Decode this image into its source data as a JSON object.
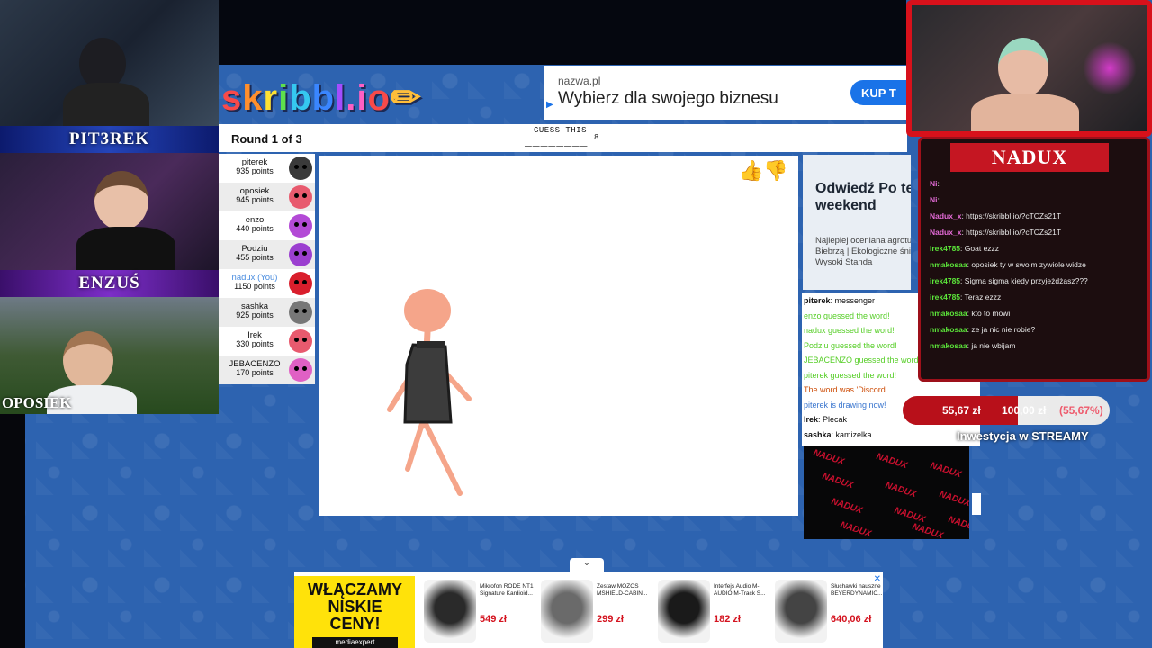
{
  "streamers": {
    "pit3rek": "PIT3REK",
    "enzus": "ENZUŚ",
    "oposiek": "OPOSIEK",
    "nadux": "NADUX"
  },
  "logo": "skribbl.io",
  "ad_top": {
    "domain": "nazwa.pl",
    "headline": "Wybierz dla swojego biznesu",
    "cta": "KUP T"
  },
  "game": {
    "round": "Round 1 of 3",
    "guess_label": "GUESS THIS",
    "word_mask": "________",
    "word_length": "8"
  },
  "players": [
    {
      "name": "piterek",
      "points": "935 points",
      "color": "#3a3a3a",
      "me": false
    },
    {
      "name": "oposiek",
      "points": "945 points",
      "color": "#e85a6e",
      "me": false
    },
    {
      "name": "enzo",
      "points": "440 points",
      "color": "#b34ad6",
      "me": false
    },
    {
      "name": "Podziu",
      "points": "455 points",
      "color": "#9b3fd0",
      "me": false
    },
    {
      "name": "nadux (You)",
      "points": "1150 points",
      "color": "#d91e2c",
      "me": true
    },
    {
      "name": "sashka",
      "points": "925 points",
      "color": "#777777",
      "me": false
    },
    {
      "name": "Irek",
      "points": "330 points",
      "color": "#e85a6e",
      "me": false
    },
    {
      "name": "JEBACENZO",
      "points": "170 points",
      "color": "#e060c4",
      "me": false
    }
  ],
  "ad_right": {
    "title": "Odwiedź Po ten weekend",
    "desc": "Najlepiej oceniana agrotu nad Biebrzą | Ekologiczne śniadania | Wysoki Standa"
  },
  "chat": [
    {
      "type": "normal",
      "user": "piterek",
      "text": "messenger"
    },
    {
      "type": "guess",
      "user": "",
      "text": "enzo guessed the word!"
    },
    {
      "type": "guess",
      "user": "",
      "text": "nadux guessed the word!"
    },
    {
      "type": "guess",
      "user": "",
      "text": "Podziu guessed the word!"
    },
    {
      "type": "guess",
      "user": "",
      "text": "JEBACENZO guessed the word!"
    },
    {
      "type": "guess",
      "user": "",
      "text": "piterek guessed the word!"
    },
    {
      "type": "word",
      "user": "",
      "text": "The word was 'Discord'"
    },
    {
      "type": "draw",
      "user": "",
      "text": "piterek is drawing now!"
    },
    {
      "type": "normal",
      "user": "Irek",
      "text": "Plecak"
    },
    {
      "type": "normal",
      "user": "sashka",
      "text": "kamizelka"
    }
  ],
  "overlay_text": "NADUX",
  "twitch_chat": [
    {
      "user": "Ni",
      "text": "",
      "pink": true
    },
    {
      "user": "Ni",
      "text": "",
      "pink": true
    },
    {
      "user": "Nadux_x",
      "text": "https://skribbl.io/?cTCZs21T",
      "pink": true
    },
    {
      "user": "Nadux_x",
      "text": "https://skribbl.io/?cTCZs21T",
      "pink": true
    },
    {
      "user": "irek4785",
      "text": "Goat ezzz",
      "pink": false
    },
    {
      "user": "nmakosaa",
      "text": "oposiek ty w swoim zywiole widze",
      "pink": false
    },
    {
      "user": "irek4785",
      "text": "Sigma sigma kiedy przyjeżdżasz???",
      "pink": false
    },
    {
      "user": "irek4785",
      "text": "Teraz ezzz",
      "pink": false
    },
    {
      "user": "nmakosaa",
      "text": "kto to mowi",
      "pink": false
    },
    {
      "user": "nmakosaa",
      "text": "ze ja nic nie robie?",
      "pink": false
    },
    {
      "user": "nmakosaa",
      "text": "ja nie wbijam",
      "pink": false
    }
  ],
  "donation": {
    "current": "55,67 zł",
    "goal": "100,00 zł",
    "percent": "(55,67%)",
    "fraction": 0.5567,
    "title": "Inwestycja w STREAMY"
  },
  "ad_bottom": {
    "promo": "WŁĄCZAMY NISKIE CENY!",
    "brand": "mediaexpert",
    "products": [
      {
        "title": "Mikrofon RODE NT1 Signature Kardioid...",
        "price": "549 zł"
      },
      {
        "title": "Zestaw MOZOS MSHIELD-CABIN...",
        "price": "299 zł"
      },
      {
        "title": "Interfejs Audio M-AUDIO M-Track S...",
        "price": "182 zł"
      },
      {
        "title": "Słuchawki nauszne BEYERDYNAMIC...",
        "price": "640,06 zł"
      }
    ]
  }
}
